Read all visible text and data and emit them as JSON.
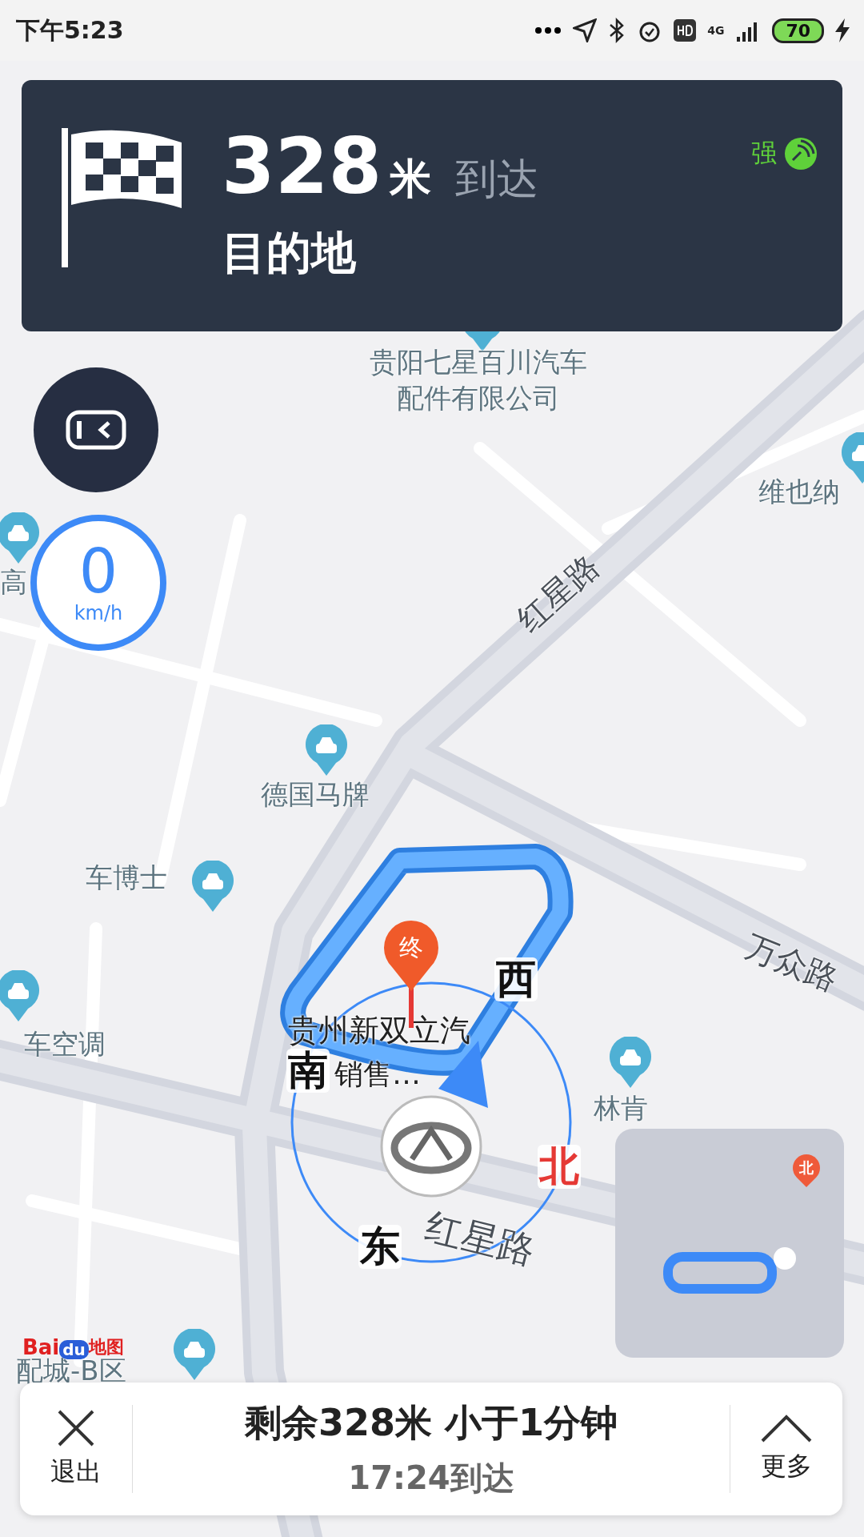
{
  "status_bar": {
    "time": "下午5:23",
    "network": "4G",
    "battery": "70"
  },
  "guidance": {
    "distance": "328",
    "unit": "米",
    "action": "到达",
    "target": "目的地",
    "signal": "强"
  },
  "speed": {
    "value": "0",
    "unit": "km/h"
  },
  "map": {
    "labels": [
      {
        "kind": "place",
        "text": "贵阳七星百川汽车"
      },
      {
        "kind": "place",
        "text": "配件有限公司"
      },
      {
        "kind": "place",
        "text": "维也纳"
      },
      {
        "kind": "place",
        "text": "高"
      },
      {
        "kind": "road",
        "text": "红星路"
      },
      {
        "kind": "place",
        "text": "德国马牌"
      },
      {
        "kind": "place",
        "text": "车博士"
      },
      {
        "kind": "road",
        "text": "万众路"
      },
      {
        "kind": "place",
        "text": "车空调"
      },
      {
        "kind": "poi",
        "text": "贵州新双立汽"
      },
      {
        "kind": "poi",
        "text": "销售…"
      },
      {
        "kind": "place",
        "text": "林肯"
      },
      {
        "kind": "road",
        "text": "红星路"
      },
      {
        "kind": "place",
        "text": "配城-B区"
      }
    ],
    "compass": [
      {
        "text": "西",
        "color": "#111111"
      },
      {
        "text": "南",
        "color": "#111111"
      },
      {
        "text": "北",
        "color": "#e53935"
      },
      {
        "text": "东",
        "color": "#111111"
      }
    ],
    "destination_marker": "终",
    "minimap_marker": "北"
  },
  "logo": {
    "parts": [
      "Bai",
      "du",
      "地图"
    ]
  },
  "bottom_bar": {
    "exit": "退出",
    "summary": "剩余328米 小于1分钟",
    "arrival": "17:24到达",
    "more": "更多"
  }
}
